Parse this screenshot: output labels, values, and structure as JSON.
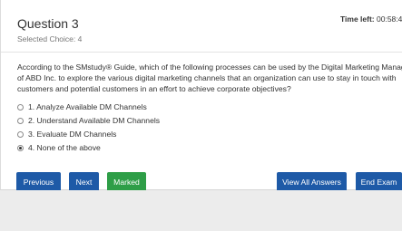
{
  "header": {
    "question_title": "Question 3",
    "selected_choice": "Selected Choice: 4",
    "time_label": "Time left:",
    "time_value": "00:58:4"
  },
  "question": {
    "lines": [
      "According to the SMstudy® Guide, which of the following processes can be used by the Digital Marketing Manager",
      "of ABD Inc. to explore the various digital marketing channels that an organization can use to stay in touch with",
      "customers and potential customers in an effort to achieve corporate objectives?"
    ]
  },
  "options": [
    {
      "label": "1. Analyze Available DM Channels",
      "checked": false
    },
    {
      "label": "2. Understand Available DM Channels",
      "checked": false
    },
    {
      "label": "3. Evaluate DM Channels",
      "checked": false
    },
    {
      "label": "4. None of the above",
      "checked": true
    }
  ],
  "buttons": {
    "previous": "Previous",
    "next": "Next",
    "marked": "Marked",
    "view_all": "View All Answers",
    "end_exam": "End Exam"
  },
  "colors": {
    "primary_button": "#1e5aa7",
    "marked_button": "#2e9e47"
  }
}
